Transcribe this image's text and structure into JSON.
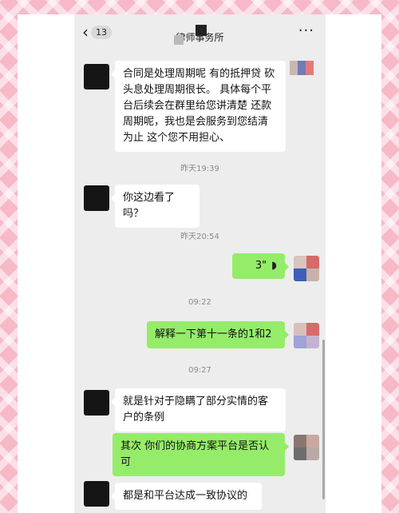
{
  "header": {
    "back_count": "13",
    "title": "律师事务所",
    "more": "···"
  },
  "messages": [
    {
      "side": "left",
      "text": "合同是处理周期呢  有的抵押贷 砍头息处理周期很长。 具体每个平台后续会在群里给您讲清楚  还款周期呢，我也是会服务到您结清为止  这个您不用担心、"
    },
    {
      "side": "left",
      "text": "你这边看了吗？"
    },
    {
      "side": "right",
      "type": "voice",
      "text": "3\""
    },
    {
      "side": "right",
      "text": "解释一下第十一条的1和2"
    },
    {
      "side": "left",
      "text": "就是针对于隐瞒了部分实情的客户的条例"
    },
    {
      "side": "right",
      "text": "其次  你们的协商方案平台是否认可"
    },
    {
      "side": "left",
      "text": "都是和平台达成一致协议的"
    }
  ],
  "timestamps": [
    "昨天19:39",
    "昨天20:54",
    "09:22",
    "09:27"
  ],
  "icons": {
    "voice": "voice-wave-icon",
    "back": "chevron-left-icon",
    "more": "more-dots-icon"
  },
  "colors": {
    "sent_bubble": "#95ec69",
    "received_bubble": "#ffffff",
    "chat_background": "#ededed",
    "outer_pattern": "#f7b8c8"
  }
}
